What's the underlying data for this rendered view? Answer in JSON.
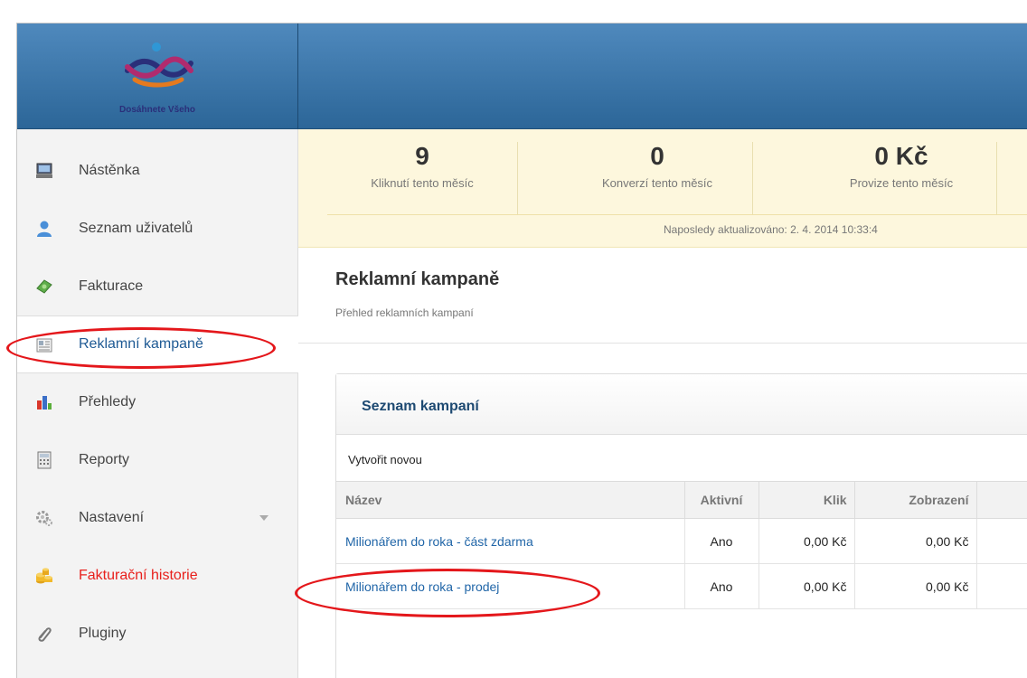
{
  "header": {
    "logo_text": "Dosáhnete Všeho"
  },
  "sidebar": {
    "items": [
      {
        "label": "Nástěnka",
        "icon": "monitor-icon"
      },
      {
        "label": "Seznam uživatelů",
        "icon": "user-icon"
      },
      {
        "label": "Fakturace",
        "icon": "money-icon"
      },
      {
        "label": "Reklamní kampaně",
        "icon": "newspaper-icon",
        "active": true
      },
      {
        "label": "Přehledy",
        "icon": "bar-chart-icon"
      },
      {
        "label": "Reporty",
        "icon": "calculator-icon"
      },
      {
        "label": "Nastavení",
        "icon": "gear-icon"
      },
      {
        "label": "Fakturační historie",
        "icon": "coins-icon"
      },
      {
        "label": "Pluginy",
        "icon": "paperclip-icon"
      }
    ]
  },
  "stats": {
    "items": [
      {
        "value": "9",
        "caption": "Kliknutí tento měsíc"
      },
      {
        "value": "0",
        "caption": "Konverzí tento měsíc"
      },
      {
        "value": "0 Kč",
        "caption": "Provize tento měsíc"
      }
    ],
    "updated": "Naposledy aktualizováno: 2. 4. 2014 10:33:4"
  },
  "page": {
    "title": "Reklamní kampaně",
    "subtitle": "Přehled reklamních kampaní"
  },
  "panel": {
    "title": "Seznam kampaní",
    "create_label": "Vytvořit novou",
    "columns": [
      "Název",
      "Aktivní",
      "Klik",
      "Zobrazení"
    ],
    "rows": [
      {
        "name": "Milionářem do roka - část zdarma",
        "active": "Ano",
        "click": "0,00 Kč",
        "views": "0,00 Kč"
      },
      {
        "name": "Milionářem do roka - prodej",
        "active": "Ano",
        "click": "0,00 Kč",
        "views": "0,00 Kč"
      }
    ]
  },
  "colors": {
    "header_blue": "#2c6698",
    "stats_bg": "#fdf7dd",
    "annotation_red": "#e4171b",
    "link_blue": "#2166a8"
  }
}
